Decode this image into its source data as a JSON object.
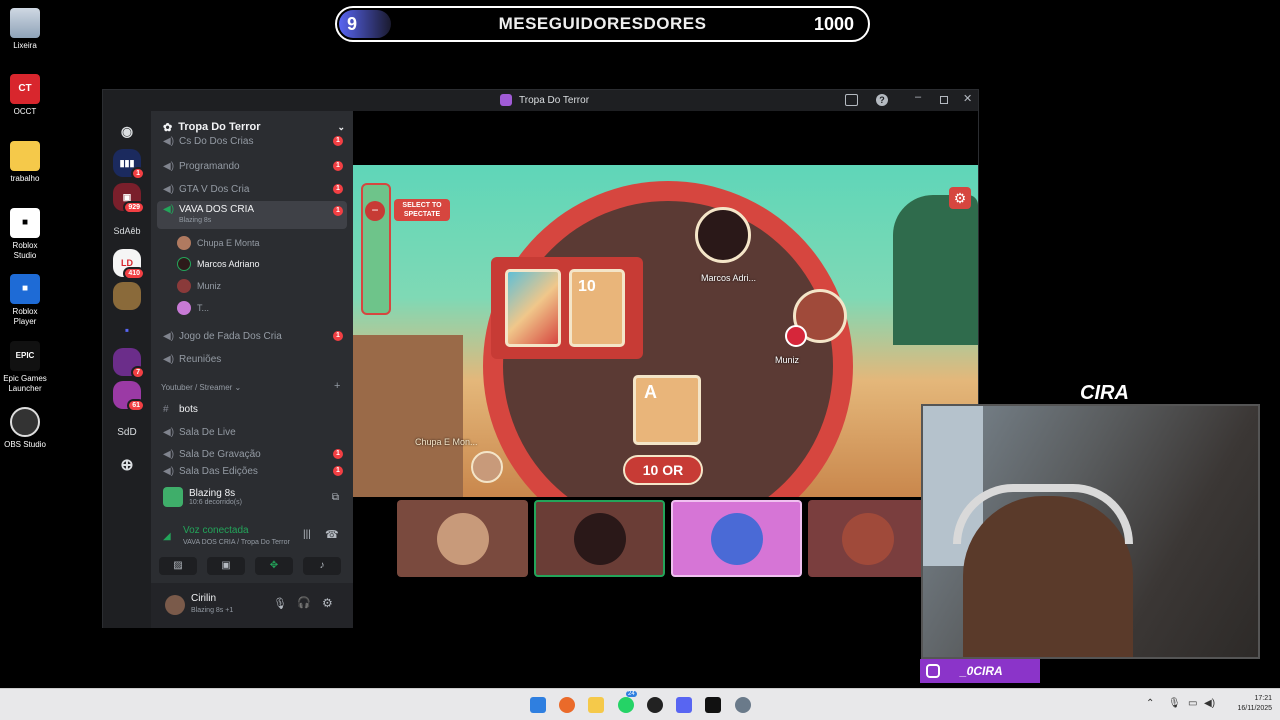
{
  "desktop": {
    "icons": [
      {
        "label": "Lixeira",
        "icon": "recycle-bin-icon"
      },
      {
        "label": "OCCT",
        "icon": "occt-icon"
      },
      {
        "label": "trabalho",
        "icon": "folder-icon"
      },
      {
        "label": "Roblox Studio",
        "icon": "roblox-studio-icon"
      },
      {
        "label": "Roblox Player",
        "icon": "roblox-player-icon"
      },
      {
        "label": "Epic Games Launcher",
        "icon": "epic-games-icon"
      },
      {
        "label": "OBS Studio",
        "icon": "obs-icon"
      }
    ]
  },
  "overlay": {
    "goal_current": "9",
    "goal_title": "MESEGUIDORESDORES",
    "goal_target": "1000",
    "webcam_name": "CIRA",
    "instagram_handle": "_0CIRA"
  },
  "discord": {
    "window_title": "Tropa Do Terror",
    "server_name": "Tropa Do Terror",
    "servers": [
      {
        "label": "",
        "badge": "1"
      },
      {
        "label": "",
        "badge": "929"
      },
      {
        "label": "SdAêb",
        "badge": ""
      },
      {
        "label": "",
        "badge": "410"
      },
      {
        "label": "",
        "badge": ""
      },
      {
        "label": "",
        "badge": ""
      },
      {
        "label": "",
        "badge": "7"
      },
      {
        "label": "",
        "badge": "61"
      },
      {
        "label": "SdD",
        "badge": ""
      }
    ],
    "channels_top": [
      {
        "name": "Cs Do Dos Crias",
        "unread": "1"
      },
      {
        "name": "Programando",
        "unread": "1"
      },
      {
        "name": "GTA V Dos Cria",
        "unread": "1"
      },
      {
        "name": "VAVA DOS CRIA",
        "unread": "1",
        "activity": "Blazing 8s"
      }
    ],
    "voice_users": [
      {
        "name": "Chupa E Monta"
      },
      {
        "name": "Marcos Adriano"
      },
      {
        "name": "Muniz"
      },
      {
        "name": "T..."
      }
    ],
    "channels_mid": [
      {
        "name": "Jogo de Fada Dos Cria",
        "unread": "1"
      },
      {
        "name": "Reuniões",
        "unread": ""
      }
    ],
    "category": "Youtuber / Streamer",
    "channels_bottom": [
      {
        "name": "bots",
        "unread": ""
      },
      {
        "name": "Sala De Live",
        "unread": ""
      },
      {
        "name": "Sala De Gravação",
        "unread": "1"
      },
      {
        "name": "Sala Das Edições",
        "unread": "1"
      }
    ],
    "activity_panel": {
      "title": "Blazing 8s",
      "subtitle": "10:6 decorrido(s)"
    },
    "voice_panel": {
      "status": "Voz conectada",
      "location": "VAVA DOS CRIA / Tropa Do Terror"
    },
    "user_panel": {
      "name": "Cirilin",
      "status": "Blazing 8s +1"
    }
  },
  "game": {
    "spectate_label": "SELECT TO SPECTATE",
    "players": [
      "Marcos Adri...",
      "Muniz",
      "Chupa E Mon..."
    ],
    "card_pile_top": "10",
    "card_hand": "A",
    "call_button": "10 OR"
  },
  "taskbar": {
    "time": "17:21",
    "date": "16/11/2025",
    "whatsapp_badge": "24"
  }
}
